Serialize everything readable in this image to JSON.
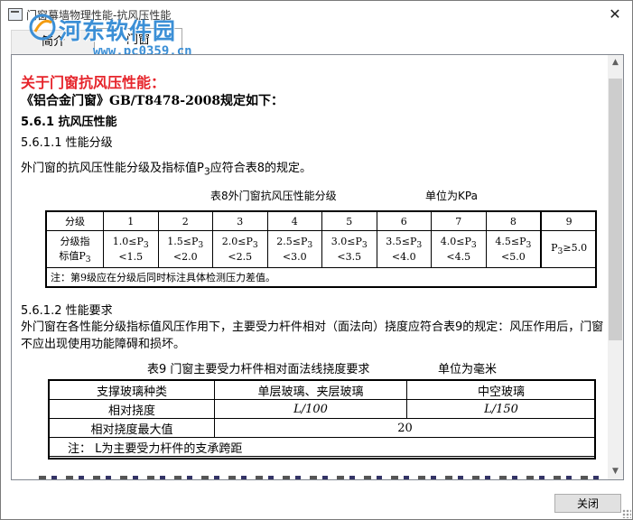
{
  "window": {
    "title": "门窗幕墙物理性能-抗风压性能"
  },
  "watermark": {
    "text": "河东软件园",
    "url": "www.pc0359.cn"
  },
  "tabs": [
    {
      "label": "简介"
    },
    {
      "label": "门窗"
    }
  ],
  "content": {
    "heading": "关于门窗抗风压性能：",
    "subheading": "《铝合金门窗》GB/T8478-2008规定如下：",
    "section_561": "5.6.1 抗风压性能",
    "section_5611": "5.6.1.1 性能分级",
    "para1_a": "外门窗的抗风压性能分级及指标值P",
    "para1_sub": "3",
    "para1_b": "应符合表8的规定。",
    "table8": {
      "caption": "表8外门窗抗风压性能分级",
      "unit": "单位为KPa",
      "header_label": "分级",
      "grades": [
        "1",
        "2",
        "3",
        "4",
        "5",
        "6",
        "7",
        "8",
        "9"
      ],
      "row_label_a": "分级指",
      "row_label_b": "标值P",
      "row_label_sub": "3",
      "indices": [
        {
          "lo": "1.0≤P",
          "hi": "<1.5"
        },
        {
          "lo": "1.5≤P",
          "hi": "<2.0"
        },
        {
          "lo": "2.0≤P",
          "hi": "<2.5"
        },
        {
          "lo": "2.5≤P",
          "hi": "<3.0"
        },
        {
          "lo": "3.0≤P",
          "hi": "<3.5"
        },
        {
          "lo": "3.5≤P",
          "hi": "<4.0"
        },
        {
          "lo": "4.0≤P",
          "hi": "<4.5"
        },
        {
          "lo": "4.5≤P",
          "hi": "<5.0"
        }
      ],
      "last_index_a": "P",
      "last_index_b": "≥5.0",
      "sub": "3",
      "note": "注：第9级应在分级后同时标注具体检测压力差值。"
    },
    "section_5612": "5.6.1.2 性能要求",
    "para2": "外门窗在各性能分级指标值风压作用下，主要受力杆件相对（面法向）挠度应符合表9的规定：风压作用后，门窗不应出现使用功能障碍和损坏。",
    "table9": {
      "caption": "表9  门窗主要受力杆件相对面法线挠度要求",
      "unit": "单位为毫米",
      "col_type": "支撑玻璃种类",
      "col_single": "单层玻璃、夹层玻璃",
      "col_hollow": "中空玻璃",
      "row_rel": "相对挠度",
      "rel_single": "L/100",
      "rel_hollow": "L/150",
      "row_max": "相对挠度最大值",
      "max_value": "20",
      "note": "注：  L为主要受力杆件的支承跨距"
    }
  },
  "footer": {
    "close_label": "关闭"
  }
}
